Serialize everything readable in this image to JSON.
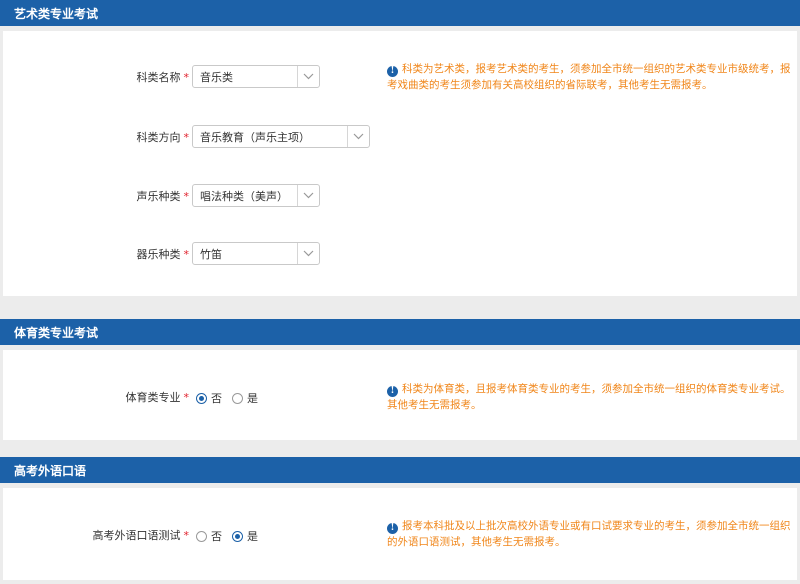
{
  "art": {
    "header": "艺术类专业考试",
    "fields": [
      {
        "label": "科类名称",
        "value": "音乐类"
      },
      {
        "label": "科类方向",
        "value": "音乐教育（声乐主项）"
      },
      {
        "label": "声乐种类",
        "value": "唱法种类（美声）"
      },
      {
        "label": "器乐种类",
        "value": "竹笛"
      }
    ],
    "note_line1": "科类为艺术类，报考艺术类的考生，须参加全市统一组织的艺术类专业市级统考，报",
    "note_line2": "考戏曲类的考生须参加有关高校组织的省际联考，其他考生无需报考。"
  },
  "sports": {
    "header": "体育类专业考试",
    "label": "体育类专业",
    "options": [
      "否",
      "是"
    ],
    "selected": "否",
    "note_line1": "科类为体育类，且报考体育类专业的考生，须参加全市统一组织的体育类专业考试。",
    "note_line2": "其他考生无需报考。"
  },
  "oral": {
    "header": "高考外语口语",
    "label": "高考外语口语测试",
    "options": [
      "否",
      "是"
    ],
    "selected": "是",
    "note_line1": "报考本科批及以上批次高校外语专业或有口试要求专业的考生，须参加全市统一组织",
    "note_line2": "的外语口语测试，其他考生无需报考。"
  },
  "required_mark": "*",
  "info_icon": "info-icon",
  "colors": {
    "header_bg": "#1c61a8",
    "note": "#f0861a",
    "required": "#e0202c"
  }
}
